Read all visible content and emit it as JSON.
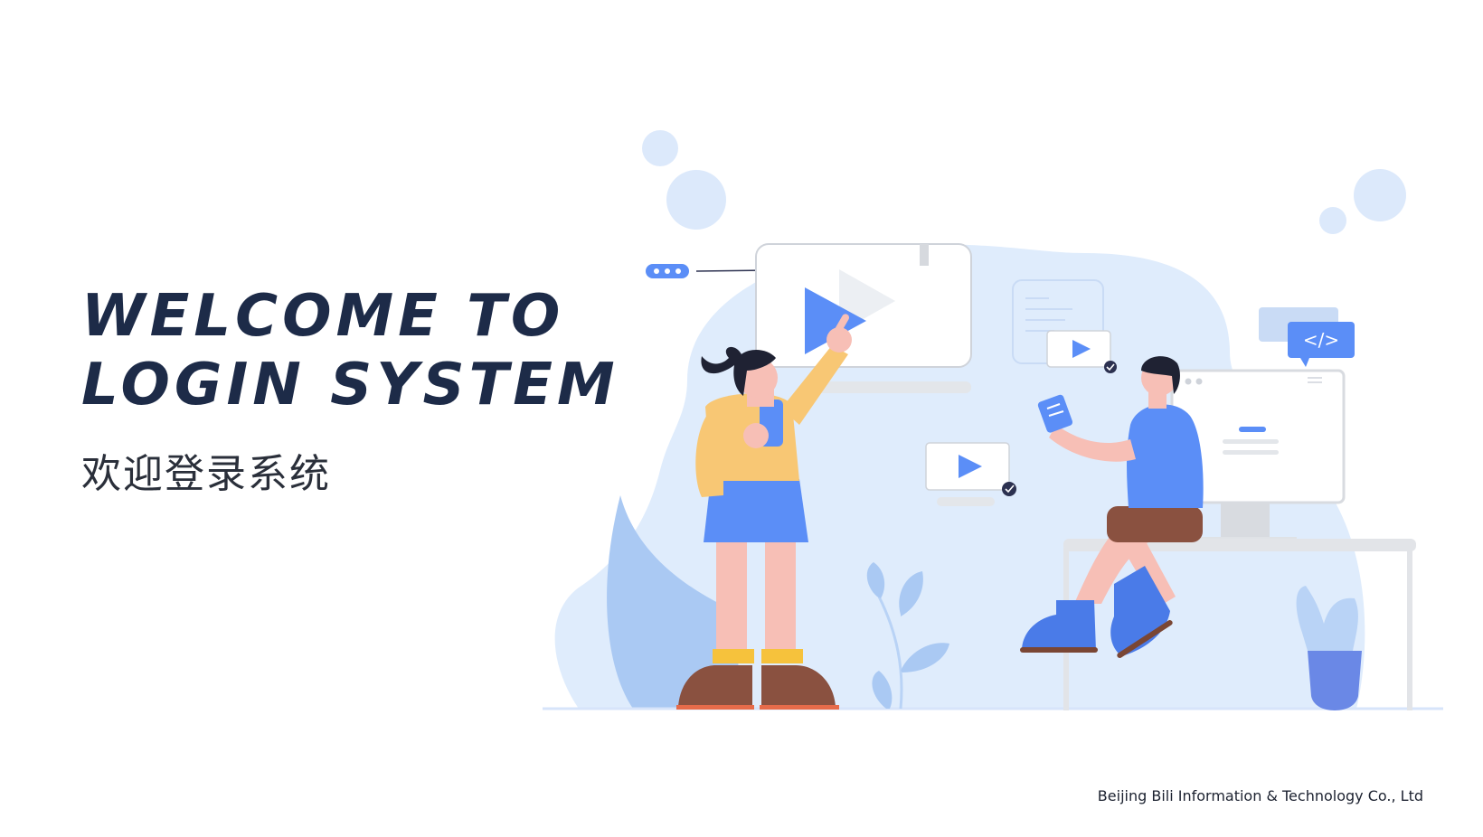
{
  "hero": {
    "title_line1": "WELCOME TO",
    "title_line2": "LOGIN SYSTEM",
    "subtitle": "欢迎登录系统"
  },
  "illustration": {
    "code_tag": "</>"
  },
  "footer": {
    "company": "Beijing Bili Information & Technology Co., Ltd"
  },
  "colors": {
    "title": "#1d2b48",
    "accent_blue": "#5b8ef7",
    "light_blue": "#dce9fb",
    "bubble": "#d3e3fa"
  }
}
